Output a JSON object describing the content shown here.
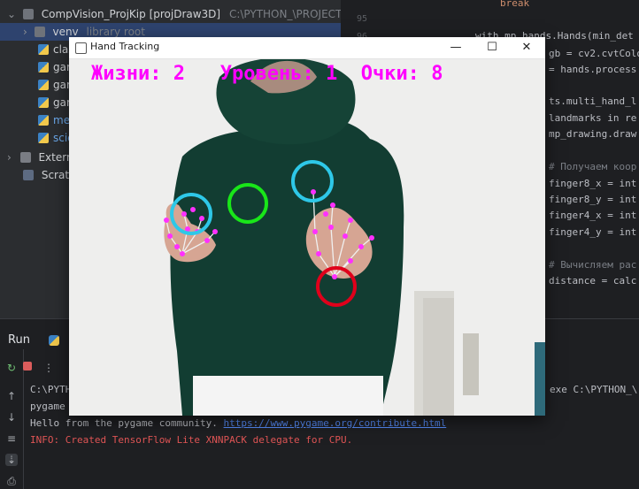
{
  "project": {
    "root_label": "CompVision_ProjKip [projDraw3D]",
    "root_path": "C:\\PYTHON_\\PROJECT_",
    "items": [
      {
        "label": "venv",
        "note": "library root",
        "icon": "folder-icon"
      },
      {
        "label": "clas",
        "icon": "python-file-icon"
      },
      {
        "label": "gam",
        "icon": "python-file-icon"
      },
      {
        "label": "gam",
        "icon": "python-file-icon"
      },
      {
        "label": "gam",
        "icon": "python-file-icon"
      },
      {
        "label": "mer",
        "icon": "python-file-icon"
      },
      {
        "label": "scie",
        "icon": "python-file-icon"
      },
      {
        "label": "Extern",
        "icon": "library-icon"
      },
      {
        "label": "Scratc",
        "icon": "scratch-icon"
      }
    ]
  },
  "editor": {
    "line_numbers": [
      "95",
      "96"
    ],
    "lines": [
      {
        "text": "break",
        "kind": "kw"
      },
      {
        "text": "with mp_hands.Hands(min_det",
        "kind": "code"
      },
      {
        "text": "gb = cv2.cvtColo",
        "kind": "code"
      },
      {
        "text": " = hands.process",
        "kind": "code"
      },
      {
        "text": "ts.multi_hand_l",
        "kind": "code"
      },
      {
        "text": "landmarks in re",
        "kind": "code"
      },
      {
        "text": "mp_drawing.draw",
        "kind": "code"
      },
      {
        "text": "# Получаем коор",
        "kind": "comment"
      },
      {
        "text": "finger8_x = int",
        "kind": "code"
      },
      {
        "text": "finger8_y = int",
        "kind": "code"
      },
      {
        "text": "finger4_x = int",
        "kind": "code"
      },
      {
        "text": "finger4_y = int",
        "kind": "code"
      },
      {
        "text": "# Вычисляем рас",
        "kind": "comment"
      },
      {
        "text": "distance = calc",
        "kind": "code"
      }
    ]
  },
  "run": {
    "tab_label": "Run",
    "console": [
      {
        "text": "C:\\PYTH",
        "tail": "exe C:\\PYTHON_\\",
        "kind": "normal"
      },
      {
        "text": "pygame",
        "kind": "normal"
      },
      {
        "text": "Hello from the pygame community. ",
        "link": "https://www.pygame.org/contribute.html",
        "kind": "normal"
      },
      {
        "text": "INFO: Created TensorFlow Lite XNNPACK delegate for CPU.",
        "kind": "error"
      }
    ]
  },
  "window": {
    "title": "Hand Tracking",
    "minimize": "—",
    "maximize": "☐",
    "close": "✕",
    "hud": {
      "lives_label": "Жизни:",
      "lives": "2",
      "level_label": "Уровень:",
      "level": "1",
      "score_label": "Очки:",
      "score": "8"
    },
    "targets": [
      {
        "name": "cyan",
        "color": "#2ec8e8"
      },
      {
        "name": "green",
        "color": "#19e619"
      },
      {
        "name": "red",
        "color": "#e0001b"
      }
    ]
  }
}
